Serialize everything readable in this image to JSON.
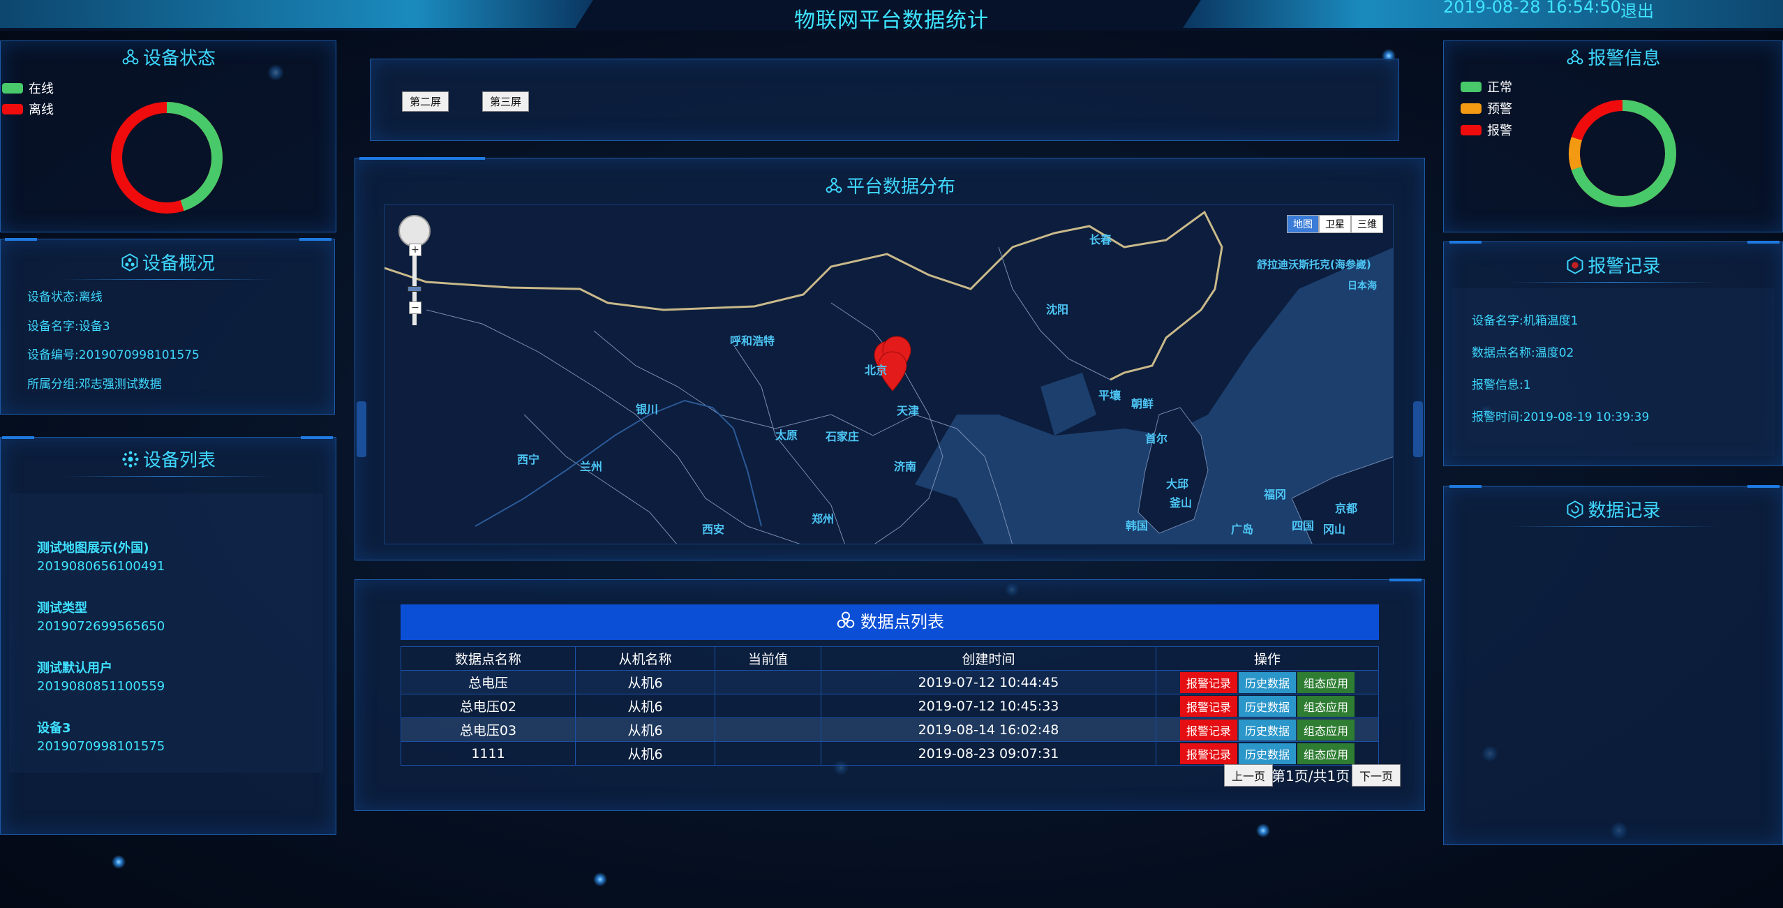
{
  "header": {
    "title": "物联网平台数据统计",
    "clock": "2019-08-28 16:54:50",
    "logout": "退出"
  },
  "device_status": {
    "title": "设备状态",
    "legend": [
      {
        "label": "在线",
        "color": "#48c96a"
      },
      {
        "label": "离线",
        "color": "#f00c0c"
      }
    ],
    "online_fraction": 0.45
  },
  "alarm_info": {
    "title": "报警信息",
    "legend": [
      {
        "label": "正常",
        "color": "#48c96a"
      },
      {
        "label": "预警",
        "color": "#f39a12"
      },
      {
        "label": "报警",
        "color": "#f00c0c"
      }
    ],
    "normal_fraction": 0.7,
    "warn_fraction": 0.1,
    "alarm_fraction": 0.2
  },
  "device_overview": {
    "title": "设备概况",
    "lines": [
      "设备状态:离线",
      "设备名字:设备3",
      "设备编号:2019070998101575",
      "所属分组:邓志强测试数据"
    ]
  },
  "device_list": {
    "title": "设备列表",
    "items": [
      {
        "name": "测试地图展示(外国)",
        "code": "2019080656100491"
      },
      {
        "name": "测试类型",
        "code": "2019072699565650"
      },
      {
        "name": "测试默认用户",
        "code": "2019080851100559"
      },
      {
        "name": "设备3",
        "code": "2019070998101575"
      }
    ]
  },
  "screens": {
    "second": "第二屏",
    "third": "第三屏"
  },
  "platform_map": {
    "title": "平台数据分布",
    "map_types": [
      "地图",
      "卫星",
      "三维"
    ],
    "labels": [
      "长春",
      "舒拉迪沃斯托克(海参崴)",
      "沈阳",
      "呼和浩特",
      "北京",
      "天津",
      "平壤",
      "朝鲜",
      "银川",
      "太原",
      "石家庄",
      "济南",
      "西宁",
      "兰州",
      "西安",
      "郑州",
      "首尔",
      "韩国",
      "大邱",
      "釜山",
      "福冈",
      "广岛",
      "京都",
      "四国",
      "冈山",
      "日本海"
    ]
  },
  "alarm_record": {
    "title": "报警记录",
    "lines": [
      "设备名字:机箱温度1",
      "数据点名称:温度02",
      "报警信息:1",
      "报警时间:2019-08-19 10:39:39"
    ]
  },
  "data_record": {
    "title": "数据记录"
  },
  "data_table": {
    "title": "数据点列表",
    "headers": [
      "数据点名称",
      "从机名称",
      "当前值",
      "创建时间",
      "操作"
    ],
    "rows": [
      {
        "name": "总电压",
        "slave": "从机6",
        "value": "",
        "created": "2019-07-12 10:44:45"
      },
      {
        "name": "总电压02",
        "slave": "从机6",
        "value": "",
        "created": "2019-07-12 10:45:33"
      },
      {
        "name": "总电压03",
        "slave": "从机6",
        "value": "",
        "created": "2019-08-14 16:02:48"
      },
      {
        "name": "1111",
        "slave": "从机6",
        "value": "",
        "created": "2019-08-23 09:07:31"
      }
    ],
    "ops": {
      "alarm": "报警记录",
      "history": "历史数据",
      "group": "组态应用"
    },
    "pager": {
      "prev": "上一页",
      "info": "第1页/共1页",
      "next": "下一页"
    }
  }
}
